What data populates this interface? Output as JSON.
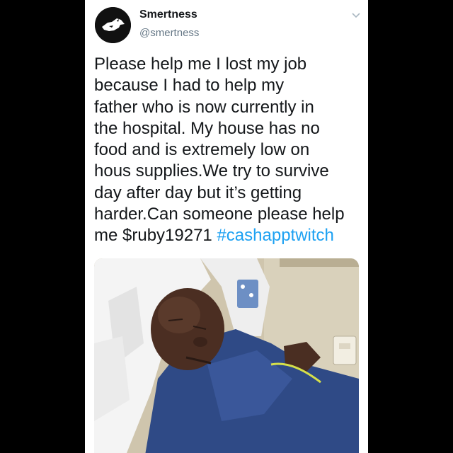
{
  "tweet": {
    "display_name": "Smertness",
    "handle": "@smertness",
    "text_lines": [
      "Please help me I lost my job",
      "because I had to help my",
      "father who is now currently in",
      "the hospital. My house has no",
      "food and is extremely low on",
      "hous supplies.We try to survive",
      "day after day but it’s getting",
      "harder.Can someone please help",
      "me $ruby19271"
    ],
    "hashtag": "#cashapptwitch",
    "photo_icon": "hospital-bed-photo",
    "menu_icon": "chevron-down-icon",
    "avatar_icon": "wolf-logo-avatar"
  },
  "colors": {
    "background": "#000000",
    "card": "#ffffff",
    "text": "#14171a",
    "secondary_text": "#657786",
    "link": "#1da1f2"
  }
}
